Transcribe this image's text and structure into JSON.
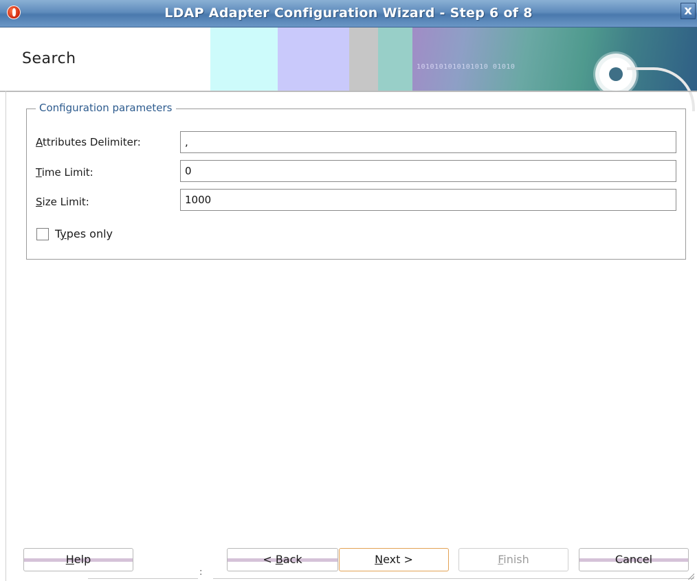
{
  "window": {
    "title": "LDAP Adapter Configuration Wizard - Step 6 of 8",
    "close_glyph": "x"
  },
  "banner": {
    "page_title": "Search",
    "binary_text": "1010101010101010 01010"
  },
  "group": {
    "legend": "Configuration parameters",
    "fields": [
      {
        "label_mnemonic": "A",
        "label_rest": "ttributes Delimiter:",
        "value": ","
      },
      {
        "label_mnemonic": "T",
        "label_rest": "ime Limit:",
        "value": "0"
      },
      {
        "label_mnemonic": "S",
        "label_rest": "ize Limit:",
        "value": "1000"
      }
    ],
    "checkbox": {
      "label_pre": "T",
      "label_mnemonic": "y",
      "label_rest": "pes only",
      "checked": false
    }
  },
  "buttons": {
    "help": {
      "mnemonic": "H",
      "rest": "elp"
    },
    "back": {
      "pre": "< ",
      "mnemonic": "B",
      "rest": "ack"
    },
    "next": {
      "mnemonic": "N",
      "rest": "ext >"
    },
    "finish": {
      "mnemonic": "F",
      "rest": "inish"
    },
    "cancel": {
      "label": "Cancel"
    }
  },
  "status": {
    "text": ":"
  }
}
